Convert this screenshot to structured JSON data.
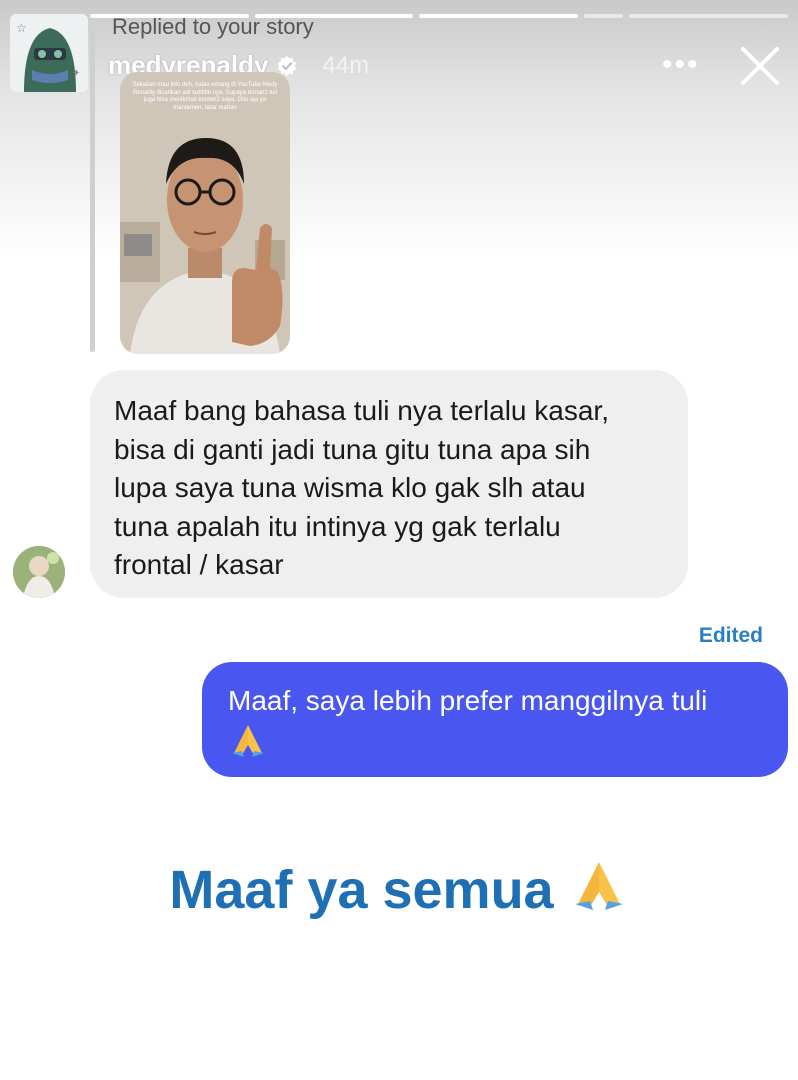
{
  "story_header": {
    "replied_label": "Replied to your story",
    "username": "medyrenaldy",
    "time": "44m",
    "more_label": "•••"
  },
  "story_thumbnail": {
    "caption": "Sekalian mau info deh, kalau emang di YouTube Medy Renaldy dicarikan adi subtitle nya. Supaya teman2 tuli juga bisa menikmati konten2 saya. Gitu aja ya mantemen, tatar mahan"
  },
  "incoming_message": {
    "lines": [
      "Maaf bang bahasa tuli nya terlalu kasar,",
      "bisa di ganti jadi tuna gitu tuna apa sih",
      "lupa saya tuna wisma klo gak slh atau",
      "tuna apalah itu intinya yg gak terlalu",
      "frontal / kasar"
    ]
  },
  "outgoing_message": {
    "edited_label": "Edited",
    "text": "Maaf, saya lebih prefer manggilnya tuli"
  },
  "overlay_caption": {
    "text": "Maaf ya semua"
  },
  "icons": [
    "verified-badge-icon",
    "more-options-icon",
    "close-icon",
    "folded-hands-emoji"
  ],
  "colors": {
    "outgoing_bubble": "#4a56f0",
    "incoming_bubble": "#efefef",
    "headline": "#1f6fb4",
    "edited": "#2a7fc0"
  }
}
